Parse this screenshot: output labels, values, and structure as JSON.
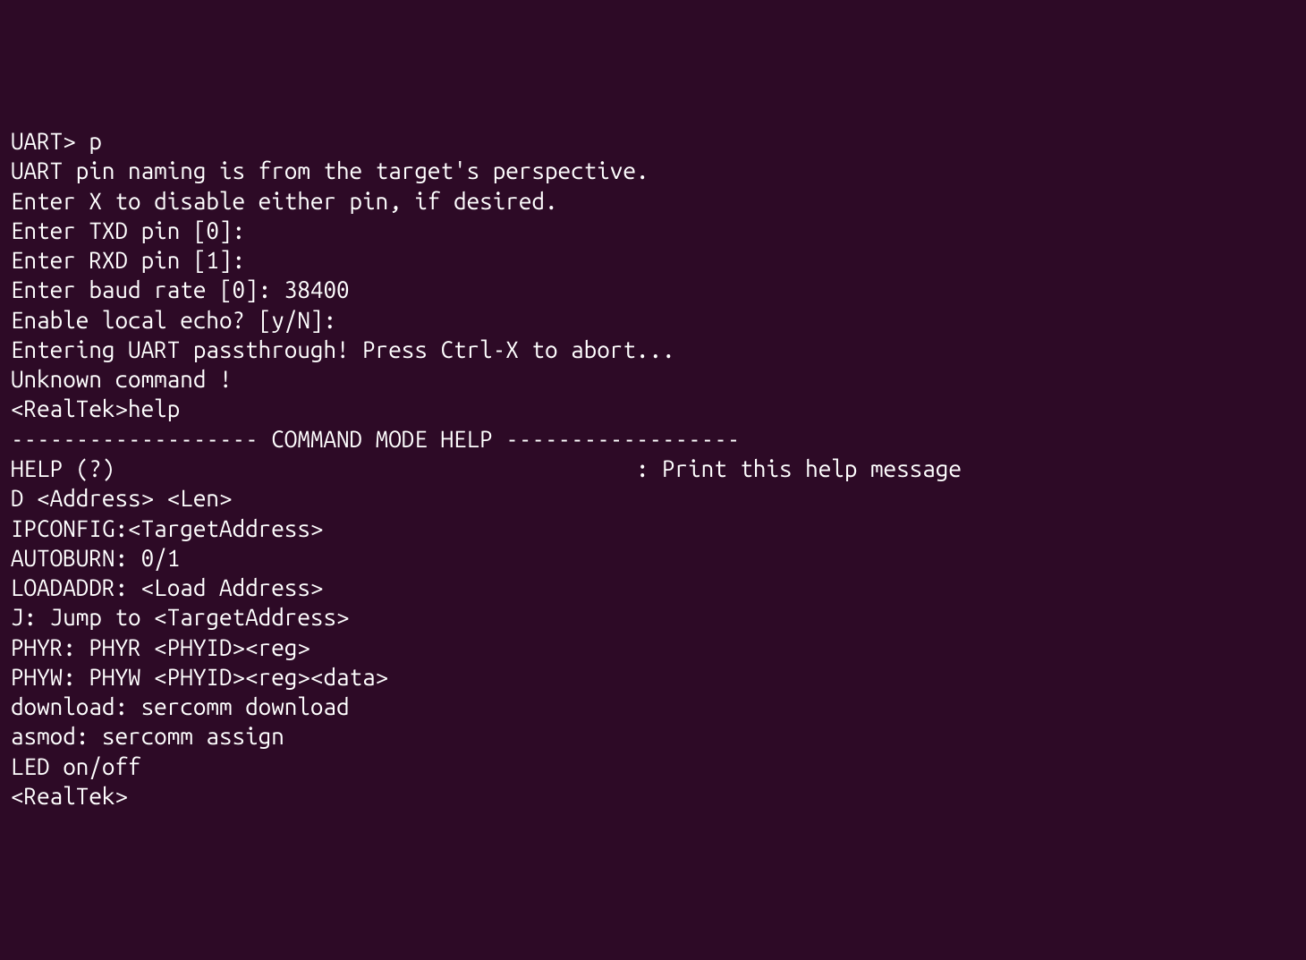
{
  "terminal": {
    "background_color": "#2d0a26",
    "foreground_color": "#ffffff",
    "lines": [
      "UART> p",
      "UART pin naming is from the target's perspective.",
      "Enter X to disable either pin, if desired.",
      "Enter TXD pin [0]:",
      "Enter RXD pin [1]:",
      "Enter baud rate [0]: 38400",
      "Enable local echo? [y/N]:",
      "Entering UART passthrough! Press Ctrl-X to abort...",
      "",
      "Unknown command !",
      "<RealTek>help",
      "------------------- COMMAND MODE HELP ------------------",
      "HELP (?)                                        : Print this help message",
      "D <Address> <Len>",
      "IPCONFIG:<TargetAddress>",
      "AUTOBURN: 0/1",
      "LOADADDR: <Load Address>",
      "J: Jump to <TargetAddress>",
      "PHYR: PHYR <PHYID><reg>",
      "PHYW: PHYW <PHYID><reg><data>",
      "download: sercomm download",
      "asmod: sercomm assign",
      "LED on/off",
      "<RealTek>"
    ]
  }
}
